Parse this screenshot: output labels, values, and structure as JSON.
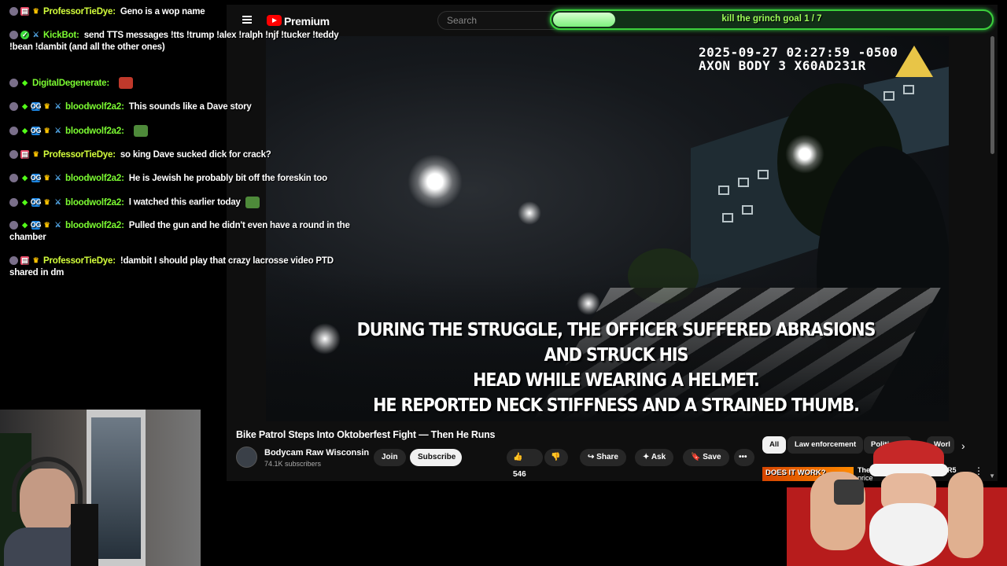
{
  "chat": {
    "messages": [
      {
        "user": "ProfessorTieDye",
        "text": "Geno is a wop name",
        "badges": [
          "avatar",
          "gift",
          "crown"
        ],
        "color": "#d4ff3c"
      },
      {
        "user": "KickBot",
        "text": "send TTS messages !tts !trump !alex !ralph !njf !tucker !teddy !bean !dambit (and all the other ones)",
        "badges": [
          "avatar",
          "verified",
          "sword"
        ],
        "color": "#7cfc32"
      },
      {
        "user": "DigitalDegenerate",
        "text": "",
        "badges": [
          "avatar",
          "diamond"
        ],
        "color": "#7cfc32",
        "emote": true
      },
      {
        "user": "bloodwolf2a2",
        "text": "This sounds like a Dave story",
        "badges": [
          "avatar",
          "diamond",
          "og",
          "crown",
          "sword"
        ],
        "color": "#7cfc32"
      },
      {
        "user": "bloodwolf2a2",
        "text": "",
        "badges": [
          "avatar",
          "diamond",
          "og",
          "crown",
          "sword"
        ],
        "color": "#7cfc32",
        "emote": true
      },
      {
        "user": "ProfessorTieDye",
        "text": "so king Dave sucked dick for crack?",
        "badges": [
          "avatar",
          "gift",
          "crown"
        ],
        "color": "#d4ff3c"
      },
      {
        "user": "bloodwolf2a2",
        "text": "He is Jewish he probably bit off the foreskin too",
        "badges": [
          "avatar",
          "diamond",
          "og",
          "crown",
          "sword"
        ],
        "color": "#7cfc32"
      },
      {
        "user": "bloodwolf2a2",
        "text": "I watched this earlier today",
        "badges": [
          "avatar",
          "diamond",
          "og",
          "crown",
          "sword"
        ],
        "color": "#7cfc32",
        "emote": true
      },
      {
        "user": "bloodwolf2a2",
        "text": "Pulled the gun and he didn't even have a round in the chamber",
        "badges": [
          "avatar",
          "diamond",
          "og",
          "crown",
          "sword"
        ],
        "color": "#7cfc32"
      },
      {
        "user": "ProfessorTieDye",
        "text": "!dambit I should play that crazy lacrosse video PTD shared in dm",
        "badges": [
          "avatar",
          "gift",
          "crown"
        ],
        "color": "#d4ff3c"
      }
    ]
  },
  "goal": {
    "label": "kill the grinch goal 1 / 7",
    "progress": 0.142857
  },
  "youtube": {
    "brand": "Premium",
    "search_placeholder": "Search",
    "video": {
      "timestamp": "2025-09-27 02:27:59 -0500",
      "device": "AXON BODY 3 X60AD231R",
      "subtitle_lines": [
        "DURING THE STRUGGLE, THE OFFICER SUFFERED ABRASIONS AND STRUCK HIS",
        "HEAD WHILE WEARING A HELMET.",
        "HE REPORTED NECK STIFFNESS AND A STRAINED THUMB."
      ]
    },
    "title": "Bike Patrol Steps Into Oktoberfest Fight — Then He Runs",
    "channel": {
      "name": "Bodycam Raw Wisconsin",
      "subscribers": "74.1K subscribers"
    },
    "buttons": {
      "join": "Join",
      "subscribe": "Subscribe",
      "likes": "546",
      "share": "Share",
      "ask": "Ask",
      "save": "Save"
    },
    "chips": [
      "All",
      "Law enforcement",
      "Politics N",
      "Worl"
    ],
    "recommended": {
      "thumb_text": "DOES IT WORK?",
      "title_start": "The $1",
      "title_end": "DDR5",
      "title_line2": "price"
    }
  }
}
